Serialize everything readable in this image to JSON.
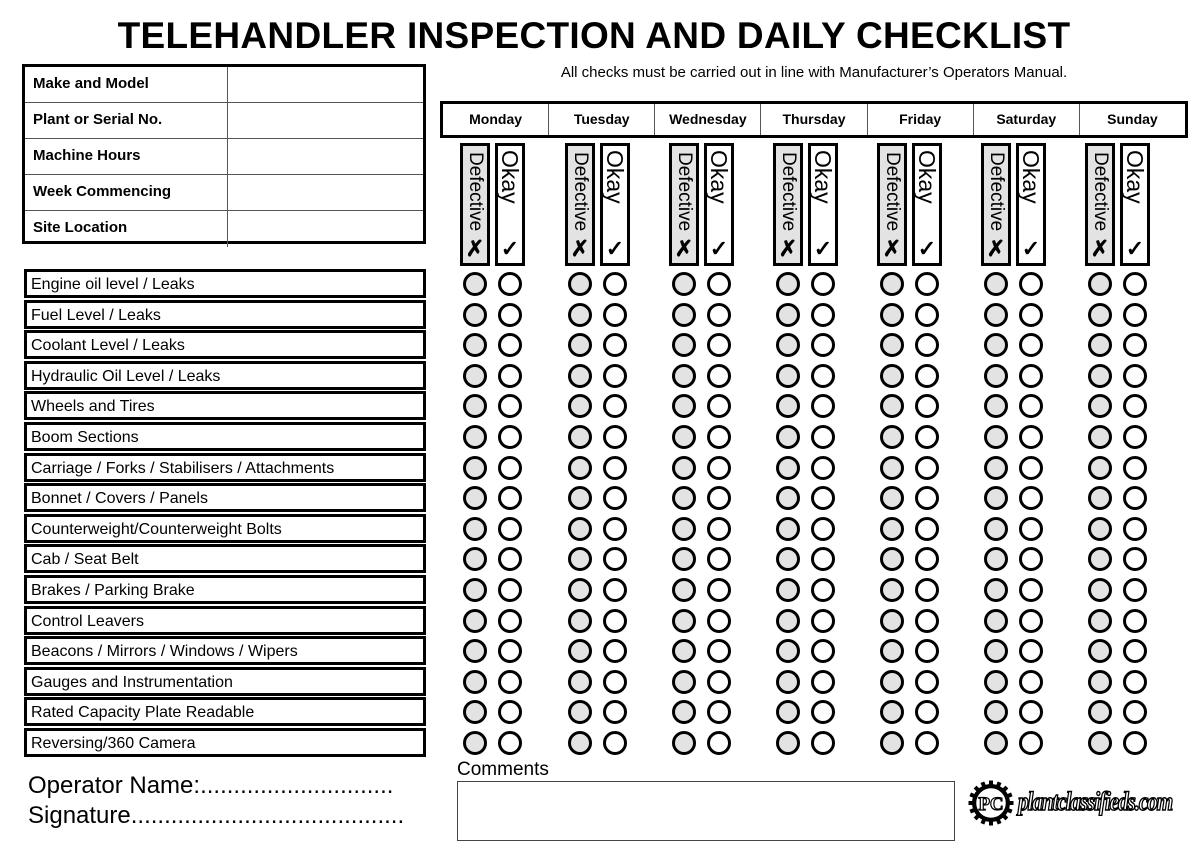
{
  "header": {
    "title": "TELEHANDLER INSPECTION AND DAILY CHECKLIST",
    "subtitle": "All checks must be carried out in line with Manufacturer’s Operators Manual."
  },
  "info_fields": [
    {
      "label": "Make and Model",
      "value": ""
    },
    {
      "label": "Plant or Serial No.",
      "value": ""
    },
    {
      "label": "Machine Hours",
      "value": ""
    },
    {
      "label": "Week Commencing",
      "value": ""
    },
    {
      "label": "Site Location",
      "value": ""
    }
  ],
  "days": [
    "Monday",
    "Tuesday",
    "Wednesday",
    "Thursday",
    "Friday",
    "Saturday",
    "Sunday"
  ],
  "status_labels": {
    "defective": "Defective",
    "defective_mark": "✗",
    "okay": "Okay",
    "okay_mark": "✓"
  },
  "checklist_items": [
    "Engine oil level / Leaks",
    "Fuel Level / Leaks",
    "Coolant Level / Leaks",
    "Hydraulic Oil Level / Leaks",
    "Wheels and Tires",
    "Boom Sections",
    "Carriage / Forks / Stabilisers / Attachments",
    "Bonnet / Covers / Panels",
    "Counterweight/Counterweight Bolts",
    "Cab / Seat Belt",
    "Brakes / Parking Brake",
    "Control Leavers",
    "Beacons / Mirrors / Windows / Wipers",
    "Gauges and Instrumentation",
    "Rated Capacity Plate Readable",
    "Reversing/360 Camera"
  ],
  "footer": {
    "operator_name": "Operator Name:.............................",
    "signature": "Signature.........................................",
    "comments_label": "Comments",
    "comments_value": ""
  },
  "logo": {
    "badge": "PC",
    "text": "plantclassifieds.com"
  },
  "colors": {
    "defective_fill": "#e3e3e3",
    "okay_fill": "#ffffff",
    "border": "#000000"
  }
}
